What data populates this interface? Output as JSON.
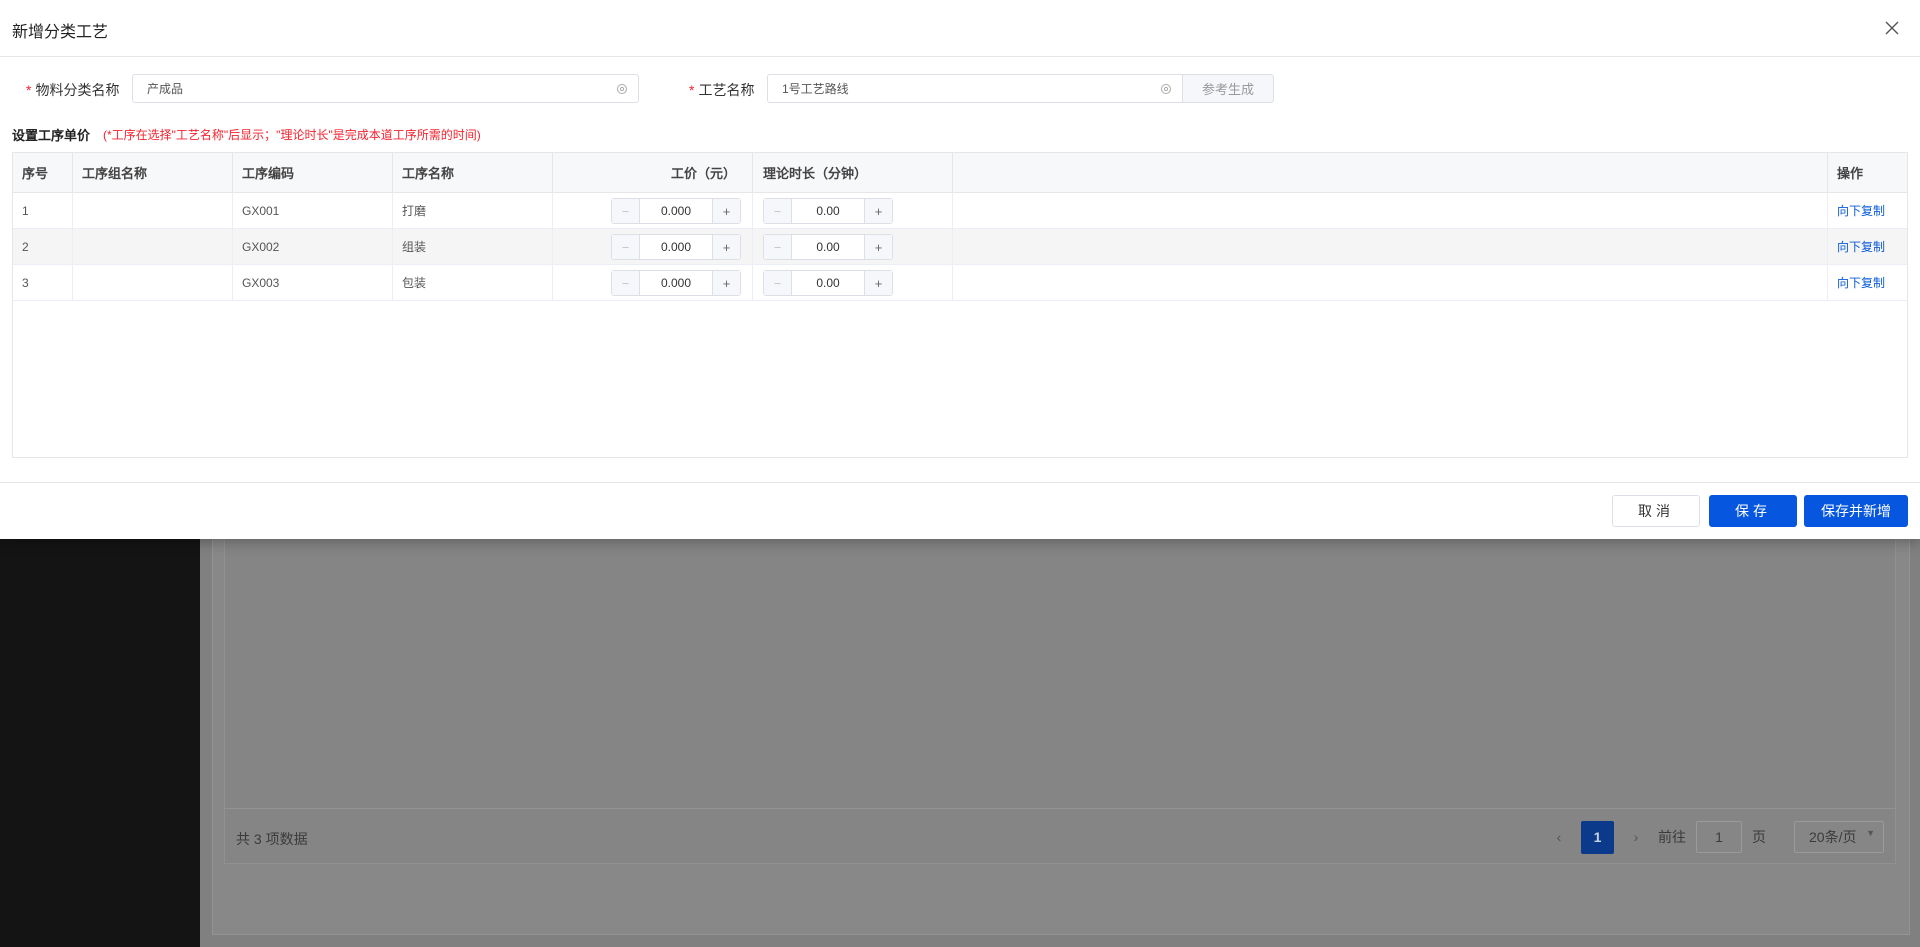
{
  "dialog": {
    "title": "新增分类工艺",
    "material_label": "物料分类名称",
    "material_value": "产成品",
    "process_label": "工艺名称",
    "process_value": "1号工艺路线",
    "ref_button": "参考生成",
    "section_title": "设置工序单价",
    "section_hint": "(*工序在选择\"工艺名称\"后显示；\"理论时长\"是完成本道工序所需的时间)",
    "columns": [
      "序号",
      "工序组名称",
      "工序编码",
      "工序名称",
      "工价（元）",
      "理论时长（分钟）",
      "",
      "操作"
    ],
    "rows": [
      {
        "no": "1",
        "group": "",
        "code": "GX001",
        "name": "打磨",
        "price": "0.000",
        "duration": "0.00",
        "action": "向下复制"
      },
      {
        "no": "2",
        "group": "",
        "code": "GX002",
        "name": "组装",
        "price": "0.000",
        "duration": "0.00",
        "action": "向下复制"
      },
      {
        "no": "3",
        "group": "",
        "code": "GX003",
        "name": "包装",
        "price": "0.000",
        "duration": "0.00",
        "action": "向下复制"
      }
    ],
    "stepper_minus": "−",
    "stepper_plus": "+",
    "cancel": "取消",
    "save": "保存",
    "save_new": "保存并新增"
  },
  "background": {
    "total": "共 3 项数据",
    "current_page": "1",
    "goto_label": "前往",
    "goto_value": "1",
    "page_unit": "页",
    "page_size": "20条/页"
  },
  "colors": {
    "primary": "#0656e0",
    "danger": "#f5222d",
    "link": "#0a5bd6"
  }
}
